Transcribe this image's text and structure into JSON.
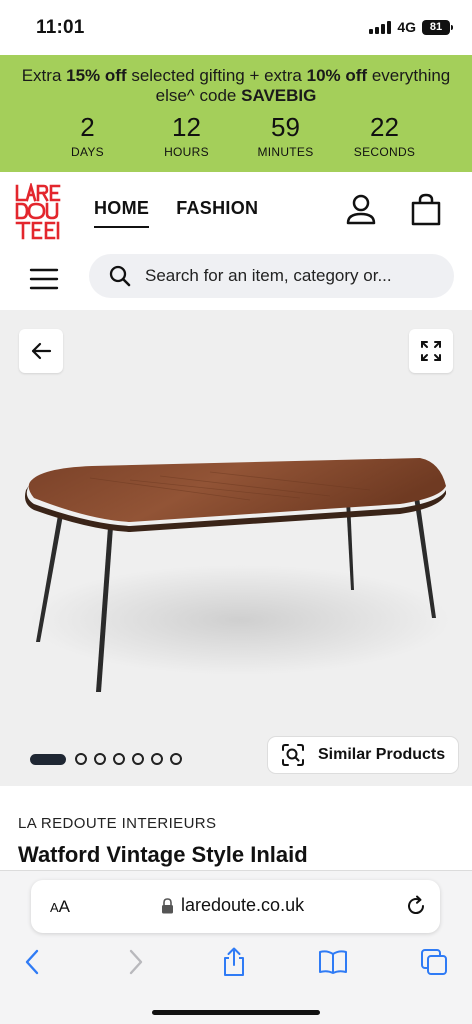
{
  "status_bar": {
    "time": "11:01",
    "network": "4G",
    "battery": "81"
  },
  "promo": {
    "text_1": "Extra ",
    "bold_1": "15% off",
    "text_2": " selected gifting + extra ",
    "bold_2": "10% off",
    "text_3": " everything else^ code ",
    "bold_3": "SAVEBIG",
    "countdown": [
      {
        "value": "2",
        "label": "DAYS"
      },
      {
        "value": "12",
        "label": "HOURS"
      },
      {
        "value": "59",
        "label": "MINUTES"
      },
      {
        "value": "22",
        "label": "SECONDS"
      }
    ]
  },
  "header": {
    "logo_text": "LA REDOUTE",
    "nav": [
      {
        "label": "HOME",
        "active": true
      },
      {
        "label": "FASHION",
        "active": false
      }
    ]
  },
  "search": {
    "placeholder": "Search for an item, category or..."
  },
  "gallery": {
    "image_count": 7,
    "active_index": 0,
    "similar_label": "Similar Products"
  },
  "product": {
    "brand": "LA REDOUTE INTERIEURS",
    "title": "Watford Vintage Style Inlaid"
  },
  "browser": {
    "aa_label": "AA",
    "url": "laredoute.co.uk"
  },
  "colors": {
    "promo_bg": "#a4cf5a",
    "logo_red": "#e3262d",
    "ios_blue": "#2f7bf5"
  }
}
